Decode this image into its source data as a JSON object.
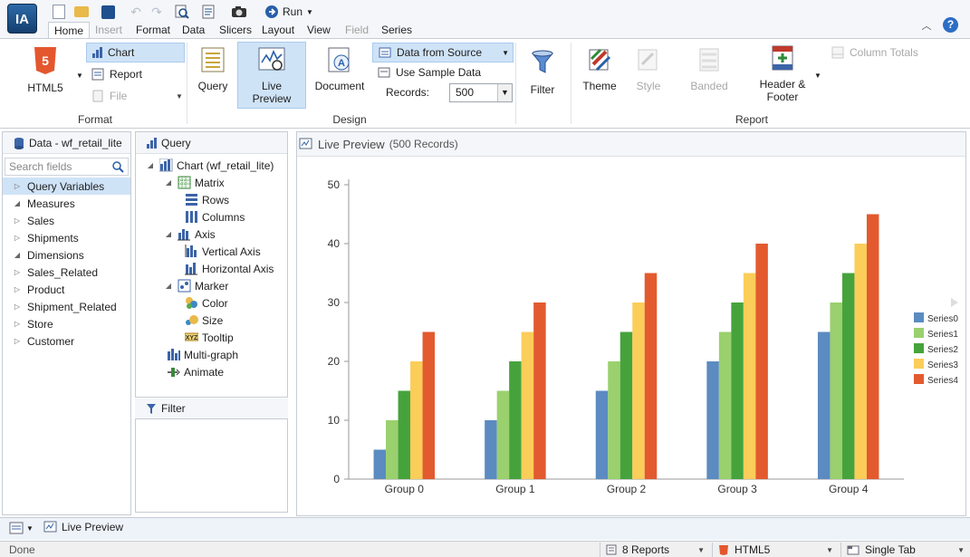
{
  "app": {
    "logo_text": "IA"
  },
  "quick_access": {
    "run_label": "Run"
  },
  "tabs": [
    {
      "label": "Home",
      "state": "active"
    },
    {
      "label": "Insert",
      "state": "disabled"
    },
    {
      "label": "Format",
      "state": "normal"
    },
    {
      "label": "Data",
      "state": "normal"
    },
    {
      "label": "Slicers",
      "state": "normal"
    },
    {
      "label": "Layout",
      "state": "normal"
    },
    {
      "label": "View",
      "state": "normal"
    },
    {
      "label": "Field",
      "state": "disabled"
    },
    {
      "label": "Series",
      "state": "normal"
    }
  ],
  "help_label": "?",
  "ribbon": {
    "format": {
      "label": "Format",
      "html5": "HTML5",
      "chart": "Chart",
      "report": "Report",
      "file": "File"
    },
    "design": {
      "label": "Design",
      "query": "Query",
      "live_preview_line1": "Live",
      "live_preview_line2": "Preview",
      "document": "Document",
      "data_from_source": "Data from Source",
      "use_sample_data": "Use Sample Data",
      "records_label": "Records:",
      "records_value": "500"
    },
    "filter": "Filter",
    "report": {
      "label": "Report",
      "theme": "Theme",
      "style": "Style",
      "banded": "Banded",
      "header_footer_line1": "Header &",
      "header_footer_line2": "Footer",
      "column_totals": "Column Totals"
    }
  },
  "data_panel": {
    "title": "Data - wf_retail_lite",
    "search_placeholder": "Search fields",
    "items": [
      {
        "label": "Query Variables",
        "level": 0,
        "expander": "closed",
        "selected": true
      },
      {
        "label": "Measures",
        "level": 0,
        "expander": "open"
      },
      {
        "label": "Sales",
        "level": 1,
        "expander": "closed"
      },
      {
        "label": "Shipments",
        "level": 1,
        "expander": "closed"
      },
      {
        "label": "Dimensions",
        "level": 0,
        "expander": "open"
      },
      {
        "label": "Sales_Related",
        "level": 1,
        "expander": "closed"
      },
      {
        "label": "Product",
        "level": 1,
        "expander": "closed"
      },
      {
        "label": "Shipment_Related",
        "level": 1,
        "expander": "closed"
      },
      {
        "label": "Store",
        "level": 1,
        "expander": "closed"
      },
      {
        "label": "Customer",
        "level": 1,
        "expander": "closed"
      }
    ]
  },
  "query_panel": {
    "title": "Query",
    "items": [
      {
        "label": "Chart (wf_retail_lite)",
        "level": 0,
        "expander": "open",
        "icon": "chart-icon"
      },
      {
        "label": "Matrix",
        "level": 1,
        "expander": "open",
        "icon": "matrix-icon"
      },
      {
        "label": "Rows",
        "level": 2,
        "expander": "none",
        "icon": "rows-icon"
      },
      {
        "label": "Columns",
        "level": 2,
        "expander": "none",
        "icon": "columns-icon"
      },
      {
        "label": "Axis",
        "level": 1,
        "expander": "open",
        "icon": "axis-icon"
      },
      {
        "label": "Vertical Axis",
        "level": 2,
        "expander": "none",
        "icon": "vertical-axis-icon"
      },
      {
        "label": "Horizontal Axis",
        "level": 2,
        "expander": "none",
        "icon": "horizontal-axis-icon"
      },
      {
        "label": "Marker",
        "level": 1,
        "expander": "open",
        "icon": "marker-icon"
      },
      {
        "label": "Color",
        "level": 2,
        "expander": "none",
        "icon": "color-icon"
      },
      {
        "label": "Size",
        "level": 2,
        "expander": "none",
        "icon": "size-icon"
      },
      {
        "label": "Tooltip",
        "level": 2,
        "expander": "none",
        "icon": "tooltip-icon"
      },
      {
        "label": "Multi-graph",
        "level": 1,
        "expander": "none",
        "icon": "multi-graph-icon"
      },
      {
        "label": "Animate",
        "level": 1,
        "expander": "none",
        "icon": "animate-icon"
      }
    ],
    "tooltip_icon_text": "XYZ"
  },
  "filter_panel": {
    "title": "Filter"
  },
  "preview": {
    "title": "Live Preview",
    "subtitle": "(500 Records)"
  },
  "chart_data": {
    "type": "bar",
    "categories": [
      "Group 0",
      "Group 1",
      "Group 2",
      "Group 3",
      "Group 4"
    ],
    "series": [
      {
        "name": "Series0",
        "color": "#5b8bc0",
        "values": [
          5,
          10,
          15,
          20,
          25
        ]
      },
      {
        "name": "Series1",
        "color": "#9ad06e",
        "values": [
          10,
          15,
          20,
          25,
          30
        ]
      },
      {
        "name": "Series2",
        "color": "#46a33c",
        "values": [
          15,
          20,
          25,
          30,
          35
        ]
      },
      {
        "name": "Series3",
        "color": "#fbcd59",
        "values": [
          20,
          25,
          30,
          35,
          40
        ]
      },
      {
        "name": "Series4",
        "color": "#e35a2f",
        "values": [
          25,
          30,
          35,
          40,
          45
        ]
      }
    ],
    "title": "",
    "xlabel": "",
    "ylabel": "",
    "ylim": [
      0,
      50
    ],
    "yticks": [
      0,
      10,
      20,
      30,
      40,
      50
    ],
    "grid": false,
    "legend": "right"
  },
  "bottom_tabs": {
    "live_preview": "Live Preview"
  },
  "status": {
    "text": "Done",
    "reports": "8 Reports",
    "format": "HTML5",
    "tab_mode": "Single Tab"
  }
}
